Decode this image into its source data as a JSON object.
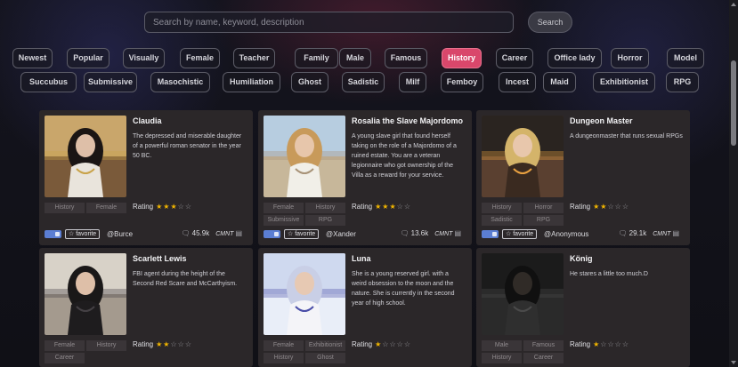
{
  "search": {
    "placeholder": "Search by name, keyword, description",
    "button_label": "Search"
  },
  "tags": {
    "row1": [
      "Newest",
      "Popular",
      "Visually",
      "Female",
      "Teacher",
      "Family",
      "Male",
      "Famous",
      "History",
      "Career",
      "Office lady",
      "Horror",
      "Model"
    ],
    "row2": [
      "Succubus",
      "Submissive",
      "Masochistic",
      "Humiliation",
      "Ghost",
      "Sadistic",
      "Milf",
      "Femboy",
      "Incest",
      "Maid",
      "Exhibitionist",
      "RPG"
    ],
    "active": "History"
  },
  "cards": [
    {
      "title": "Claudia",
      "description": "The depressed and miserable daughter of a powerful roman senator in the year 50 BC.",
      "tags": [
        "History",
        "Female"
      ],
      "rating_label": "Rating",
      "rating": 3,
      "favorite_label": "☆ favorite",
      "author": "@Burce",
      "chats": "45.9k",
      "cmnt_label": "CMNT",
      "colors": {
        "sky": "#c9a66b",
        "bg": "#7a5a3a",
        "hair": "#1a1514",
        "outfit": "#e9e4dc",
        "accent": "#c9a34a"
      }
    },
    {
      "title": "Rosalia the Slave Majordomo",
      "description": "A young slave girl that found herself taking on the role of a Majordomo of a ruined estate. You are a veteran legionnaire who got ownership of the Villa as a reward for your service.",
      "tags": [
        "Female",
        "History",
        "Submissive",
        "RPG"
      ],
      "rating_label": "Rating",
      "rating": 3,
      "favorite_label": "☆ favorite",
      "author": "@Xander",
      "chats": "13.6k",
      "cmnt_label": "CMNT",
      "colors": {
        "sky": "#b7cde0",
        "bg": "#c7b79a",
        "hair": "#c89a5a",
        "outfit": "#f1efe8",
        "accent": "#a89378"
      }
    },
    {
      "title": "Dungeon Master",
      "description": "A dungeonmaster that runs sexual RPGs",
      "tags": [
        "History",
        "Horror",
        "Sadistic",
        "RPG"
      ],
      "rating_label": "Rating",
      "rating": 2,
      "favorite_label": "☆ favorite",
      "author": "@Anonymous",
      "chats": "29.1k",
      "cmnt_label": "CMNT",
      "colors": {
        "sky": "#2a2420",
        "bg": "#5a4030",
        "hair": "#d4b46a",
        "outfit": "#3a2a20",
        "accent": "#e8a040"
      }
    },
    {
      "title": "Scarlett Lewis",
      "description": "FBI agent during the height of the Second Red Scare and McCarthyism.",
      "tags": [
        "Female",
        "History",
        "Career"
      ],
      "rating_label": "Rating",
      "rating": 2,
      "colors": {
        "sky": "#d8d2c8",
        "bg": "#a49a8e",
        "hair": "#1a1818",
        "outfit": "#1e1c1e",
        "accent": "#444044"
      }
    },
    {
      "title": "Luna",
      "description": "She is a young reserved girl. with a weird obsession to the moon and the nature. She is currently in the second year of high school.",
      "tags": [
        "Female",
        "Exhibitionist",
        "History",
        "Ghost"
      ],
      "rating_label": "Rating",
      "rating": 1,
      "colors": {
        "sky": "#cfd9ef",
        "bg": "#e9eef8",
        "hair": "#c9cfe6",
        "outfit": "#f4f4f8",
        "accent": "#4a4ea8"
      }
    },
    {
      "title": "König",
      "description": "He stares a little too much.D",
      "tags": [
        "Male",
        "Famous",
        "History",
        "Career"
      ],
      "rating_label": "Rating",
      "rating": 1,
      "colors": {
        "sky": "#1b1b1b",
        "bg": "#2a2a2a",
        "hair": "#101010",
        "outfit": "#2f2f2f",
        "accent": "#4a4a4a"
      }
    }
  ]
}
